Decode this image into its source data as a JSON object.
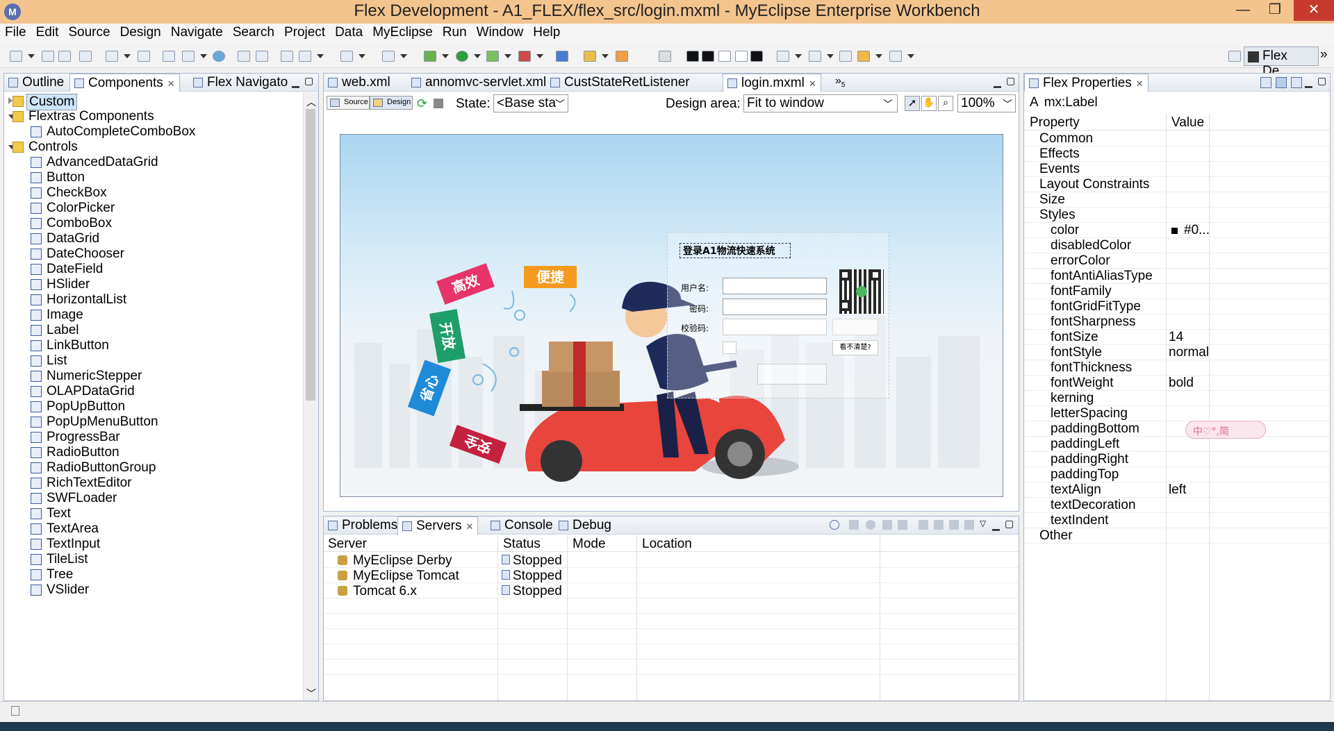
{
  "window": {
    "title": "Flex Development - A1_FLEX/flex_src/login.mxml - MyEclipse Enterprise Workbench",
    "app_icon": "M"
  },
  "menu": [
    "File",
    "Edit",
    "Source",
    "Design",
    "Navigate",
    "Search",
    "Project",
    "Data",
    "MyEclipse",
    "Run",
    "Window",
    "Help"
  ],
  "perspective": {
    "label": "Flex De...",
    "more": "»"
  },
  "left_panel": {
    "tabs": [
      "Outline",
      "Components",
      "Flex Navigato"
    ],
    "tree": [
      {
        "label": "Custom",
        "indent": 0,
        "type": "folder",
        "expanded": false,
        "selected": true
      },
      {
        "label": "Flextras Components",
        "indent": 0,
        "type": "folder",
        "expanded": true
      },
      {
        "label": "AutoCompleteComboBox",
        "indent": 1,
        "type": "item"
      },
      {
        "label": "Controls",
        "indent": 0,
        "type": "folder",
        "expanded": true
      },
      {
        "label": "AdvancedDataGrid",
        "indent": 1,
        "type": "item"
      },
      {
        "label": "Button",
        "indent": 1,
        "type": "item"
      },
      {
        "label": "CheckBox",
        "indent": 1,
        "type": "item"
      },
      {
        "label": "ColorPicker",
        "indent": 1,
        "type": "item"
      },
      {
        "label": "ComboBox",
        "indent": 1,
        "type": "item"
      },
      {
        "label": "DataGrid",
        "indent": 1,
        "type": "item"
      },
      {
        "label": "DateChooser",
        "indent": 1,
        "type": "item"
      },
      {
        "label": "DateField",
        "indent": 1,
        "type": "item"
      },
      {
        "label": "HSlider",
        "indent": 1,
        "type": "item"
      },
      {
        "label": "HorizontalList",
        "indent": 1,
        "type": "item"
      },
      {
        "label": "Image",
        "indent": 1,
        "type": "item"
      },
      {
        "label": "Label",
        "indent": 1,
        "type": "item"
      },
      {
        "label": "LinkButton",
        "indent": 1,
        "type": "item"
      },
      {
        "label": "List",
        "indent": 1,
        "type": "item"
      },
      {
        "label": "NumericStepper",
        "indent": 1,
        "type": "item"
      },
      {
        "label": "OLAPDataGrid",
        "indent": 1,
        "type": "item"
      },
      {
        "label": "PopUpButton",
        "indent": 1,
        "type": "item"
      },
      {
        "label": "PopUpMenuButton",
        "indent": 1,
        "type": "item"
      },
      {
        "label": "ProgressBar",
        "indent": 1,
        "type": "item"
      },
      {
        "label": "RadioButton",
        "indent": 1,
        "type": "item"
      },
      {
        "label": "RadioButtonGroup",
        "indent": 1,
        "type": "item"
      },
      {
        "label": "RichTextEditor",
        "indent": 1,
        "type": "item"
      },
      {
        "label": "SWFLoader",
        "indent": 1,
        "type": "item"
      },
      {
        "label": "Text",
        "indent": 1,
        "type": "item"
      },
      {
        "label": "TextArea",
        "indent": 1,
        "type": "item"
      },
      {
        "label": "TextInput",
        "indent": 1,
        "type": "item"
      },
      {
        "label": "TileList",
        "indent": 1,
        "type": "item"
      },
      {
        "label": "Tree",
        "indent": 1,
        "type": "item"
      },
      {
        "label": "VSlider",
        "indent": 1,
        "type": "item"
      }
    ]
  },
  "editor": {
    "tabs": [
      "web.xml",
      "annomvc-servlet.xml",
      "CustStateRetListener",
      "login.mxml"
    ],
    "active_tab": "login.mxml",
    "overflow": "»",
    "overflow_count": "5",
    "mode_buttons": [
      "Source",
      "Design"
    ],
    "state_label": "State:",
    "state_value": "<Base sta",
    "design_area_label": "Design area:",
    "design_area_value": "Fit to window",
    "zoom_value": "100%"
  },
  "canvas": {
    "login_title": "登录A1物流快速系统",
    "username_label": "用户名:",
    "password_label": "密码:",
    "captcha_label": "校验码:",
    "unclear_link": "看不清楚?",
    "signs": [
      "高效",
      "便捷",
      "开放",
      "省心",
      "安全"
    ]
  },
  "bottom_panel": {
    "tabs": [
      "Problems",
      "Servers",
      "Console",
      "Debug"
    ],
    "active_tab": "Servers",
    "columns": [
      "Server",
      "Status",
      "Mode",
      "Location"
    ],
    "rows": [
      {
        "server": "MyEclipse Derby",
        "status": "Stopped",
        "mode": "",
        "location": ""
      },
      {
        "server": "MyEclipse Tomcat",
        "status": "Stopped",
        "mode": "",
        "location": ""
      },
      {
        "server": "Tomcat  6.x",
        "status": "Stopped",
        "mode": "",
        "location": ""
      }
    ]
  },
  "right_panel": {
    "tab": "Flex Properties",
    "component": "mx:Label",
    "columns": [
      "Property",
      "Value"
    ],
    "rows": [
      {
        "k": "Common",
        "v": "",
        "level": 1
      },
      {
        "k": "Effects",
        "v": "",
        "level": 1
      },
      {
        "k": "Events",
        "v": "",
        "level": 1
      },
      {
        "k": "Layout Constraints",
        "v": "",
        "level": 1
      },
      {
        "k": "Size",
        "v": "",
        "level": 1
      },
      {
        "k": "Styles",
        "v": "",
        "level": 1
      },
      {
        "k": "color",
        "v": "#0...",
        "level": 2,
        "swatch": "#000000"
      },
      {
        "k": "disabledColor",
        "v": "",
        "level": 2
      },
      {
        "k": "errorColor",
        "v": "",
        "level": 2
      },
      {
        "k": "fontAntiAliasType",
        "v": "",
        "level": 2
      },
      {
        "k": "fontFamily",
        "v": "",
        "level": 2
      },
      {
        "k": "fontGridFitType",
        "v": "",
        "level": 2
      },
      {
        "k": "fontSharpness",
        "v": "",
        "level": 2
      },
      {
        "k": "fontSize",
        "v": "14",
        "level": 2
      },
      {
        "k": "fontStyle",
        "v": "normal",
        "level": 2
      },
      {
        "k": "fontThickness",
        "v": "",
        "level": 2
      },
      {
        "k": "fontWeight",
        "v": "bold",
        "level": 2
      },
      {
        "k": "kerning",
        "v": "",
        "level": 2
      },
      {
        "k": "letterSpacing",
        "v": "",
        "level": 2
      },
      {
        "k": "paddingBottom",
        "v": "",
        "level": 2
      },
      {
        "k": "paddingLeft",
        "v": "",
        "level": 2
      },
      {
        "k": "paddingRight",
        "v": "",
        "level": 2
      },
      {
        "k": "paddingTop",
        "v": "",
        "level": 2
      },
      {
        "k": "textAlign",
        "v": "left",
        "level": 2
      },
      {
        "k": "textDecoration",
        "v": "",
        "level": 2
      },
      {
        "k": "textIndent",
        "v": "",
        "level": 2
      },
      {
        "k": "Other",
        "v": "",
        "level": 1
      }
    ]
  },
  "ime_widget": "中♡°,简",
  "colors": {
    "titlebar": "#f4c48e",
    "close": "#c7392c",
    "selection": "#cde4fa",
    "panel_border": "#a8b8cc"
  }
}
